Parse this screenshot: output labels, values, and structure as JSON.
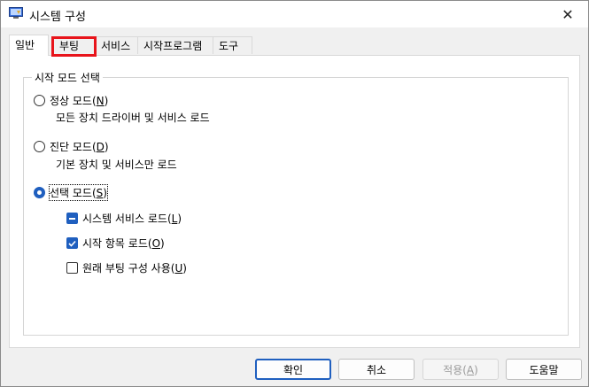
{
  "window": {
    "title": "시스템 구성",
    "close_glyph": "✕"
  },
  "tabs": [
    {
      "label": "일반",
      "active": true
    },
    {
      "label": "부팅",
      "active": false
    },
    {
      "label": "서비스",
      "active": false
    },
    {
      "label": "시작프로그램",
      "active": false
    },
    {
      "label": "도구",
      "active": false
    }
  ],
  "startup": {
    "group_label": "시작 모드 선택",
    "normal": {
      "label": "정상 모드(",
      "key": "N",
      "end": ")",
      "desc": "모든 장치 드라이버 및 서비스 로드",
      "checked": false
    },
    "diagnostic": {
      "label": "진단 모드(",
      "key": "D",
      "end": ")",
      "desc": "기본 장치 및 서비스만 로드",
      "checked": false
    },
    "selective": {
      "label": "선택 모드(",
      "key": "S",
      "end": ")",
      "checked": true
    },
    "options": [
      {
        "label": "시스템 서비스 로드(",
        "key": "L",
        "end": ")",
        "state": "indeterminate"
      },
      {
        "label": "시작 항목 로드(",
        "key": "O",
        "end": ")",
        "state": "checked"
      },
      {
        "label": "원래 부팅 구성 사용(",
        "key": "U",
        "end": ")",
        "state": "unchecked"
      }
    ]
  },
  "buttons": {
    "ok": "확인",
    "cancel": "취소",
    "apply": "적용(",
    "apply_key": "A",
    "apply_end": ")",
    "help": "도움말"
  },
  "colors": {
    "accent": "#1f5fbf",
    "highlight": "#e8141b"
  }
}
